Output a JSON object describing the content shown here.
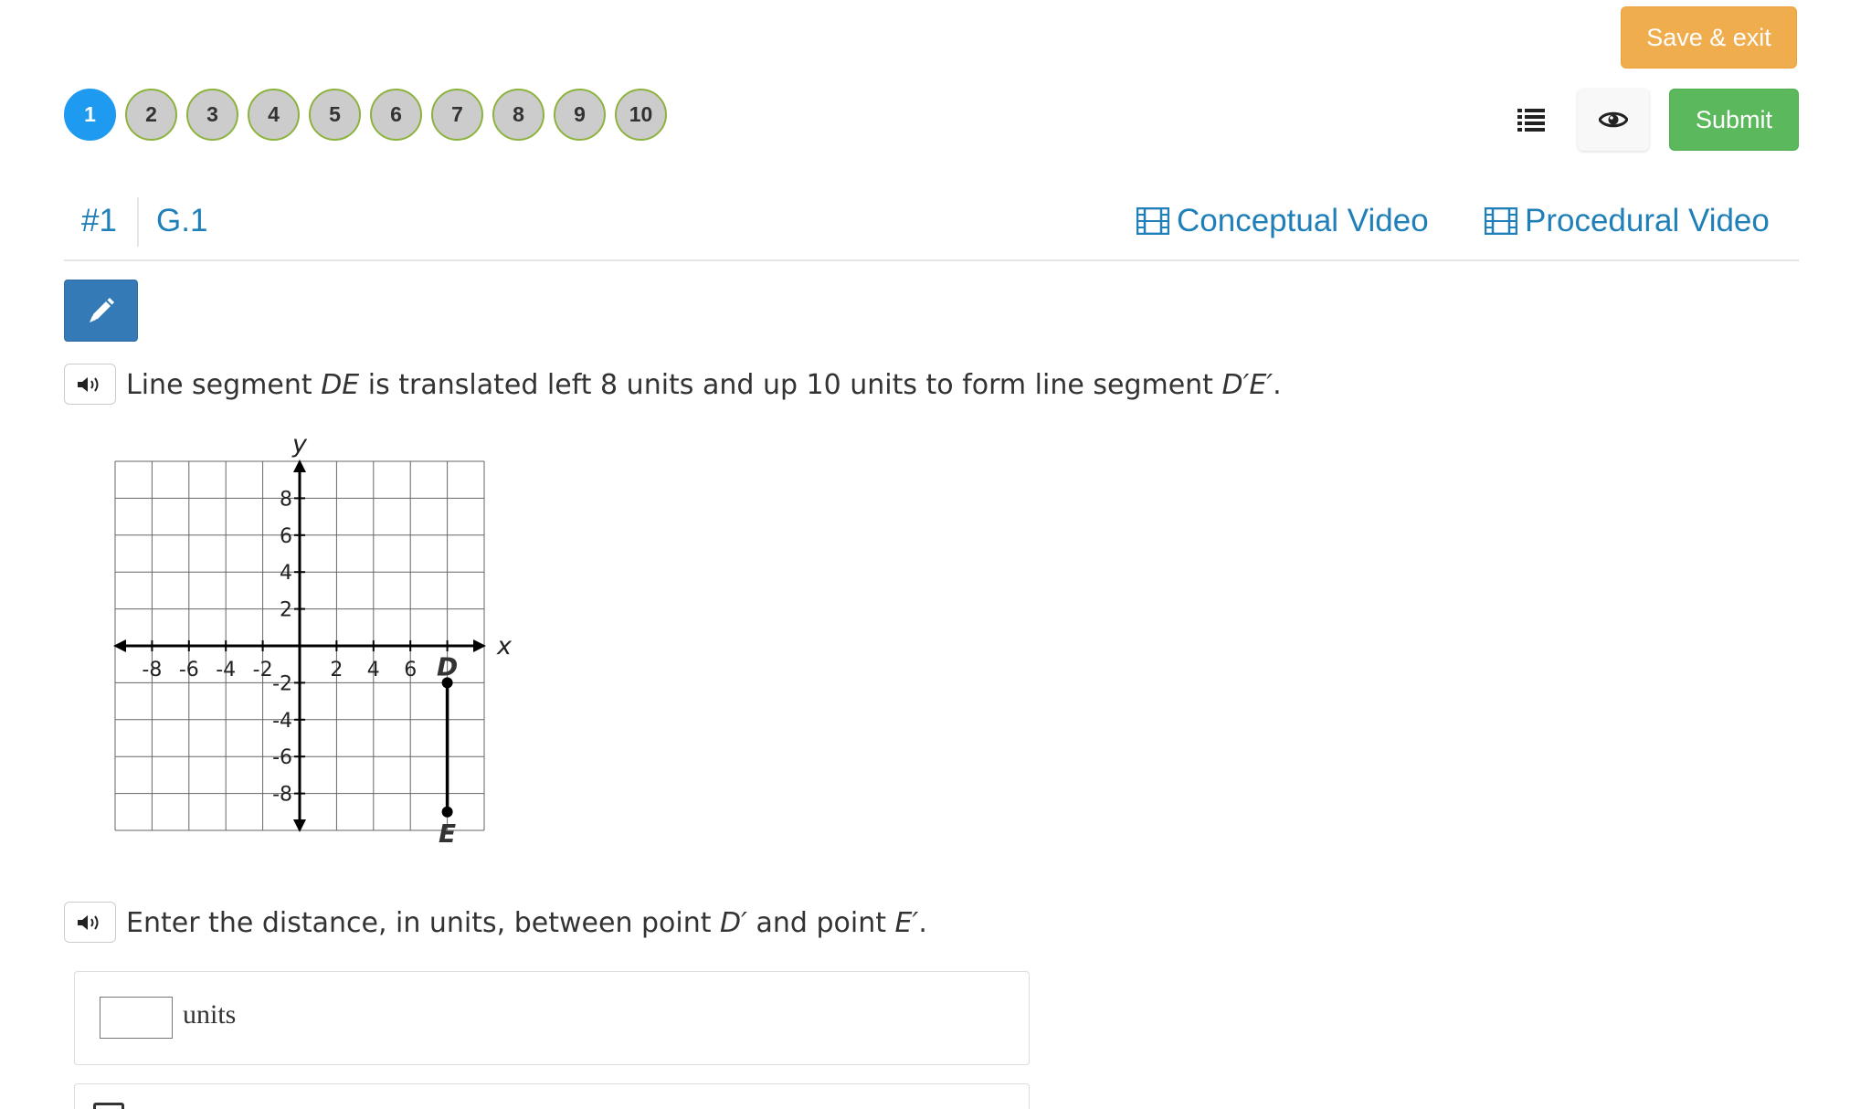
{
  "toolbar": {
    "save_exit_label": "Save & exit",
    "submit_label": "Submit",
    "list_icon": "list-icon",
    "eye_icon": "eye-icon"
  },
  "question_nav": {
    "current": 1,
    "items": [
      "1",
      "2",
      "3",
      "4",
      "5",
      "6",
      "7",
      "8",
      "9",
      "10"
    ]
  },
  "header": {
    "question_number": "#1",
    "standard": "G.1",
    "conceptual_video": "Conceptual Video",
    "procedural_video": "Procedural Video"
  },
  "prompt1": {
    "before": "Line segment ",
    "seg": "DE",
    "middle": " is translated left 8 units and up 10 units to form line segment ",
    "seg_prime": "D′E′",
    "end": "."
  },
  "graph": {
    "x_label": "x",
    "y_label": "y",
    "x_ticks": [
      "-8",
      "-6",
      "-4",
      "-2",
      "2",
      "4",
      "6"
    ],
    "y_ticks": [
      "8",
      "6",
      "4",
      "2",
      "-2",
      "-4",
      "-6",
      "-8"
    ],
    "points": [
      {
        "label": "D",
        "x": 8,
        "y": -2
      },
      {
        "label": "E",
        "x": 8,
        "y": -9
      }
    ],
    "range": {
      "xmin": -10,
      "xmax": 10,
      "ymin": -10,
      "ymax": 10
    }
  },
  "prompt2": {
    "before": "Enter the distance, in units, between point ",
    "p1": "D′",
    "middle": " and point ",
    "p2": "E′",
    "end": "."
  },
  "answer": {
    "value": "",
    "unit": "units"
  },
  "colors": {
    "primary_link": "#1f7fb8",
    "active_nav": "#1e9bf0",
    "save_exit": "#f0ad4e",
    "submit": "#5cb85c",
    "pencil": "#337ab7"
  }
}
